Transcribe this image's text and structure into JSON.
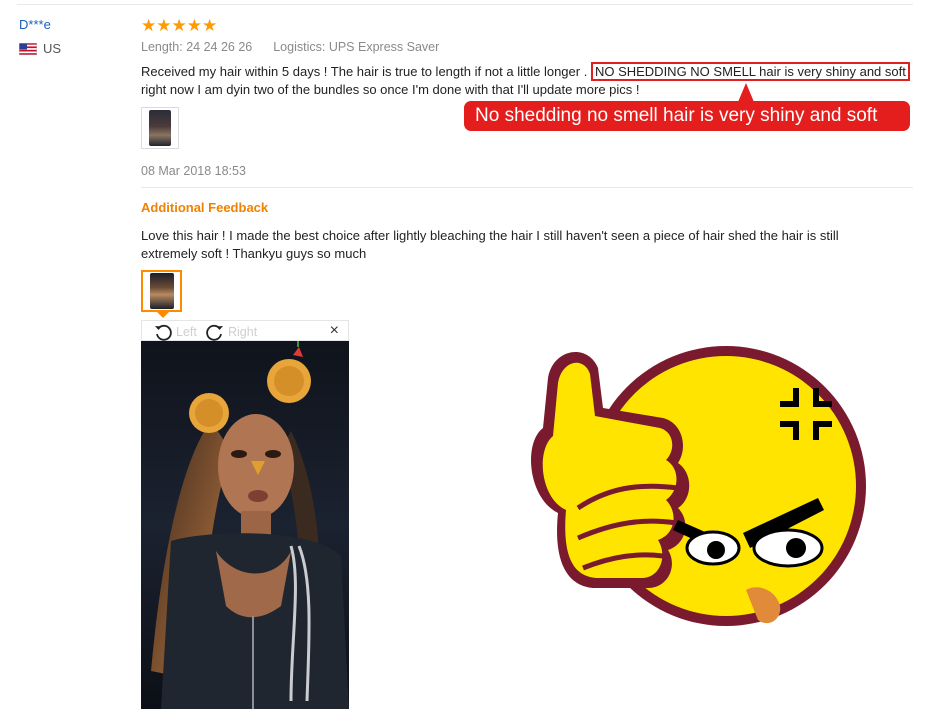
{
  "reviewer": {
    "name": "D***e",
    "country": "US",
    "flag_icon": "us-flag-icon"
  },
  "review": {
    "rating_stars": "★★★★★",
    "rating_value": 5,
    "length_label": "Length:",
    "length_value": "24 24 26 26",
    "logistics_label": "Logistics:",
    "logistics_value": "UPS Express Saver",
    "text_before": "Received my hair within 5 days ! The hair is true to length if not a little longer .",
    "text_highlight": "NO SHEDDING NO SMELL hair is very shiny and soft",
    "text_after": "right now I am dyin two of the bundles so once I'm done with that I'll update more pics !",
    "date": "08 Mar 2018 18:53"
  },
  "additional_feedback": {
    "title": "Additional Feedback",
    "text": "Love this hair !  I made the best choice after lightly bleaching the hair I still haven't seen a piece of hair shed the hair is still extremely soft ! Thankyu guys so much"
  },
  "viewer": {
    "rotate_left_label": "Left",
    "rotate_right_label": "Right",
    "close_label": "×"
  },
  "callout": {
    "text": "No shedding no smell hair is very shiny and soft"
  },
  "colors": {
    "star": "#ff9a00",
    "reviewer_name": "#1c60b8",
    "accent_orange": "#f08200",
    "callout_red": "#e41d1d",
    "emoji_yellow": "#ffe400",
    "emoji_outline": "#7a1a2e"
  }
}
